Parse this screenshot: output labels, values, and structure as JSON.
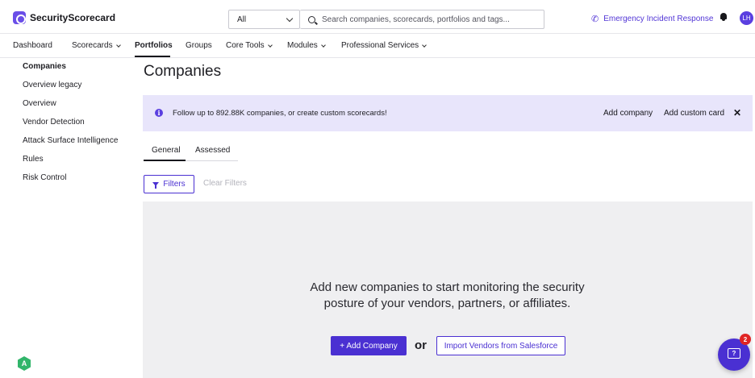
{
  "header": {
    "logo_text": "SecurityScorecard",
    "search_scope": "All",
    "search_placeholder": "Search companies, scorecards, portfolios and tags...",
    "emergency_label": "Emergency Incident Response",
    "avatar_initials": "LH"
  },
  "nav": {
    "items": [
      {
        "label": "Dashboard"
      },
      {
        "label": "Scorecards"
      },
      {
        "label": "Portfolios"
      },
      {
        "label": "Groups"
      },
      {
        "label": "Core Tools"
      },
      {
        "label": "Modules"
      },
      {
        "label": "Professional Services"
      }
    ],
    "active": "Portfolios"
  },
  "sidebar": {
    "items": [
      {
        "label": "Companies"
      },
      {
        "label": "Overview legacy"
      },
      {
        "label": "Overview"
      },
      {
        "label": "Vendor Detection"
      },
      {
        "label": "Attack Surface Intelligence"
      },
      {
        "label": "Rules"
      },
      {
        "label": "Risk Control"
      }
    ],
    "badge_letter": "A"
  },
  "main": {
    "title": "Companies",
    "banner": {
      "text": "Follow up to 892.88K companies, or create custom scorecards!",
      "add_company": "Add company",
      "add_custom_card": "Add custom card",
      "close": "✕"
    },
    "tabs": [
      {
        "label": "General"
      },
      {
        "label": "Assessed"
      }
    ],
    "filters_label": "Filters",
    "clear_filters_label": "Clear Filters",
    "empty_state": {
      "message": "Add new companies to start monitoring the security posture of your vendors, partners, or affiliates.",
      "add_company_button": "+ Add Company",
      "or_text": "or",
      "import_button": "Import Vendors from Salesforce"
    }
  },
  "chat": {
    "badge_count": "2",
    "icon_glyph": "?"
  },
  "colors": {
    "accent": "#4a30d2",
    "banner_bg": "#e8e5fb",
    "empty_bg": "#efeff1",
    "badge_red": "#e02424",
    "green_badge": "#31b56a"
  }
}
